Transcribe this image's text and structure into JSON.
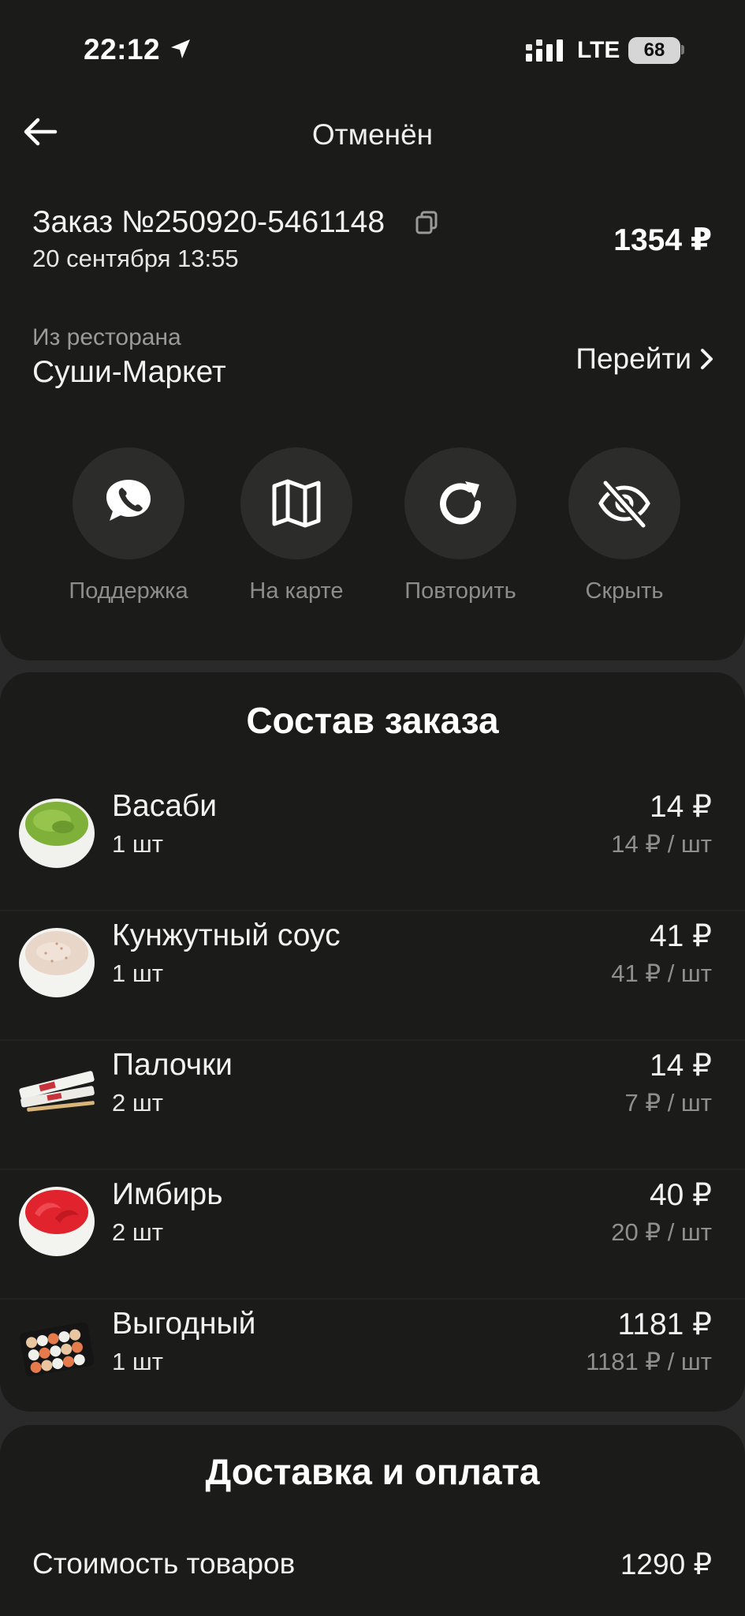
{
  "status_bar": {
    "time": "22:12",
    "network": "LTE",
    "battery": "68"
  },
  "header": {
    "title": "Отменён"
  },
  "order": {
    "number": "Заказ №250920-5461148",
    "date": "20 сентября 13:55",
    "total": "1354 ₽"
  },
  "restaurant": {
    "label": "Из ресторана",
    "name": "Суши-Маркет",
    "goto_label": "Перейти"
  },
  "actions": [
    {
      "label": "Поддержка",
      "icon": "support-chat-icon"
    },
    {
      "label": "На карте",
      "icon": "map-icon"
    },
    {
      "label": "Повторить",
      "icon": "repeat-icon"
    },
    {
      "label": "Скрыть",
      "icon": "eye-off-icon"
    }
  ],
  "items_section": {
    "title": "Состав заказа",
    "items": [
      {
        "name": "Васаби",
        "qty": "1 шт",
        "price": "14 ₽",
        "unit_price": "14 ₽ / шт",
        "image": "wasabi"
      },
      {
        "name": "Кунжутный соус",
        "qty": "1 шт",
        "price": "41 ₽",
        "unit_price": "41 ₽ / шт",
        "image": "sesame-sauce"
      },
      {
        "name": "Палочки",
        "qty": "2 шт",
        "price": "14 ₽",
        "unit_price": "7 ₽ / шт",
        "image": "chopsticks"
      },
      {
        "name": "Имбирь",
        "qty": "2 шт",
        "price": "40 ₽",
        "unit_price": "20 ₽ / шт",
        "image": "ginger"
      },
      {
        "name": "Выгодный",
        "qty": "1 шт",
        "price": "1181 ₽",
        "unit_price": "1181 ₽ / шт",
        "image": "sushi-set"
      }
    ]
  },
  "delivery_section": {
    "title": "Доставка и оплата",
    "goods_cost_label": "Стоимость товаров",
    "goods_cost_value": "1290 ₽"
  }
}
